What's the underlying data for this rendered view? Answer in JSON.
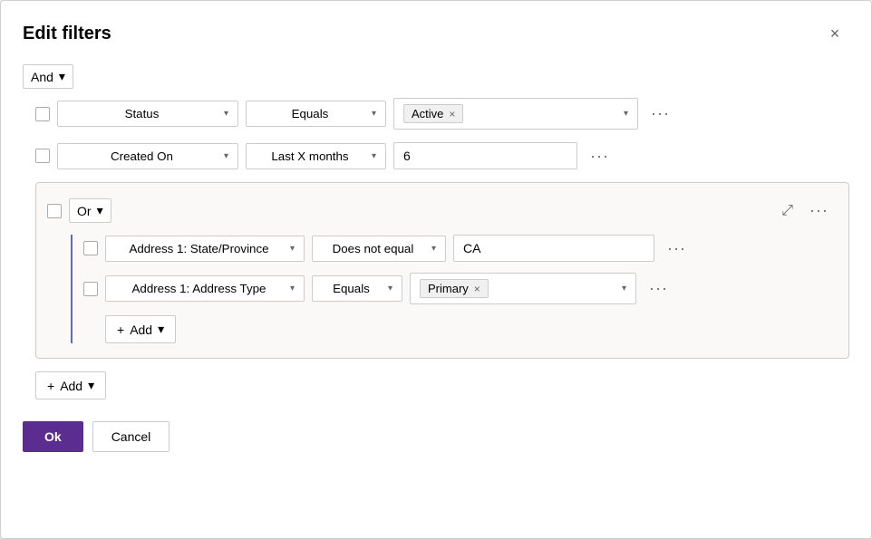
{
  "dialog": {
    "title": "Edit filters",
    "close_label": "×"
  },
  "and_section": {
    "label": "And",
    "arrow": "▾"
  },
  "filters": [
    {
      "field": "Status",
      "operator": "Equals",
      "value_tag": "Active",
      "value_type": "tag"
    },
    {
      "field": "Created On",
      "operator": "Last X months",
      "value": "6",
      "value_type": "text"
    }
  ],
  "or_group": {
    "label": "Or",
    "arrow": "▾",
    "collapse_icon": "⤢",
    "more": "···",
    "rows": [
      {
        "field": "Address 1: State/Province",
        "operator": "Does not equal",
        "value": "CA",
        "value_type": "text"
      },
      {
        "field": "Address 1: Address Type",
        "operator": "Equals",
        "value_tag": "Primary",
        "value_type": "tag"
      }
    ],
    "add_label": "Add",
    "add_arrow": "▾"
  },
  "outer_add": {
    "label": "Add",
    "arrow": "▾"
  },
  "footer": {
    "ok_label": "Ok",
    "cancel_label": "Cancel"
  }
}
